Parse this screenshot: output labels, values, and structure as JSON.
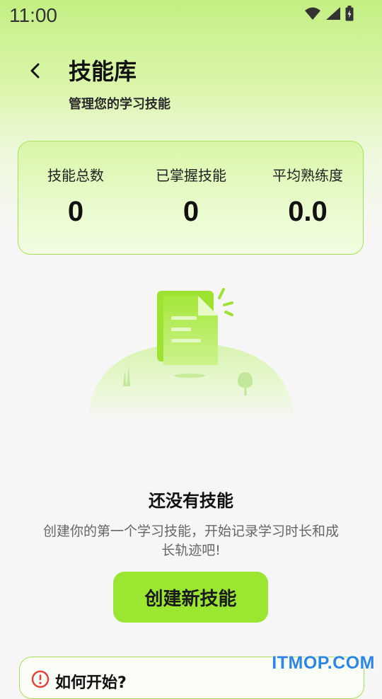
{
  "status_bar": {
    "time": "11:00"
  },
  "header": {
    "title": "技能库",
    "subtitle": "管理您的学习技能"
  },
  "stats": [
    {
      "label": "技能总数",
      "value": "0"
    },
    {
      "label": "已掌握技能",
      "value": "0"
    },
    {
      "label": "平均熟练度",
      "value": "0.0"
    }
  ],
  "empty_state": {
    "title": "还没有技能",
    "description": "创建你的第一个学习技能，开始记录学习时长和成长轨迹吧!",
    "button_label": "创建新技能"
  },
  "help_card": {
    "title": "如何开始?"
  },
  "watermark": "ITMOP.COM",
  "colors": {
    "accent": "#9be630",
    "card_border": "#a6e356",
    "watermark": "#2b86e8"
  },
  "icons": [
    "back-arrow-icon",
    "wifi-icon",
    "signal-icon",
    "battery-icon",
    "document-icon",
    "alert-icon"
  ]
}
